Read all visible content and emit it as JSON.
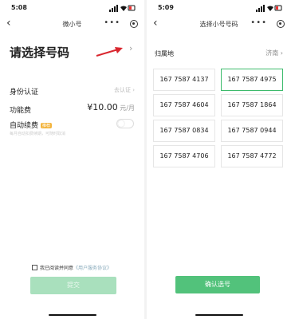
{
  "left": {
    "status_time": "5:08",
    "back_icon": "‹",
    "title": "微小号",
    "more_icon": "•••",
    "heading": "请选择号码",
    "chevron": "›",
    "identity": {
      "label": "身份认证",
      "value": "去认证 ›"
    },
    "fee": {
      "label": "功能费",
      "price": "¥10.00",
      "unit": " 元/月"
    },
    "renew": {
      "label": "自动续费",
      "badge": "推荐",
      "note": "每月自动扣费续期，可随时取消"
    },
    "agree": {
      "text": "我已阅读并同意",
      "link": "《用户服务协议》"
    },
    "submit_label": "提交"
  },
  "right": {
    "status_time": "5:09",
    "back_icon": "‹",
    "title": "选择小号号码",
    "more_icon": "•••",
    "region": {
      "label": "归属地",
      "value": "济南 ›"
    },
    "numbers": [
      {
        "value": "167 7587 4137",
        "selected": false
      },
      {
        "value": "167 7587 4975",
        "selected": true
      },
      {
        "value": "167 7587 4604",
        "selected": false
      },
      {
        "value": "167 7587 1864",
        "selected": false
      },
      {
        "value": "167 7587 0834",
        "selected": false
      },
      {
        "value": "167 7587 0944",
        "selected": false
      },
      {
        "value": "167 7587 4706",
        "selected": false
      },
      {
        "value": "167 7587 4772",
        "selected": false
      }
    ],
    "confirm_label": "确认选号"
  },
  "colors": {
    "accent": "#52c27b",
    "accent_disabled": "#a9e0bd",
    "arrow": "#d9262e",
    "badge": "#f3b53f"
  }
}
